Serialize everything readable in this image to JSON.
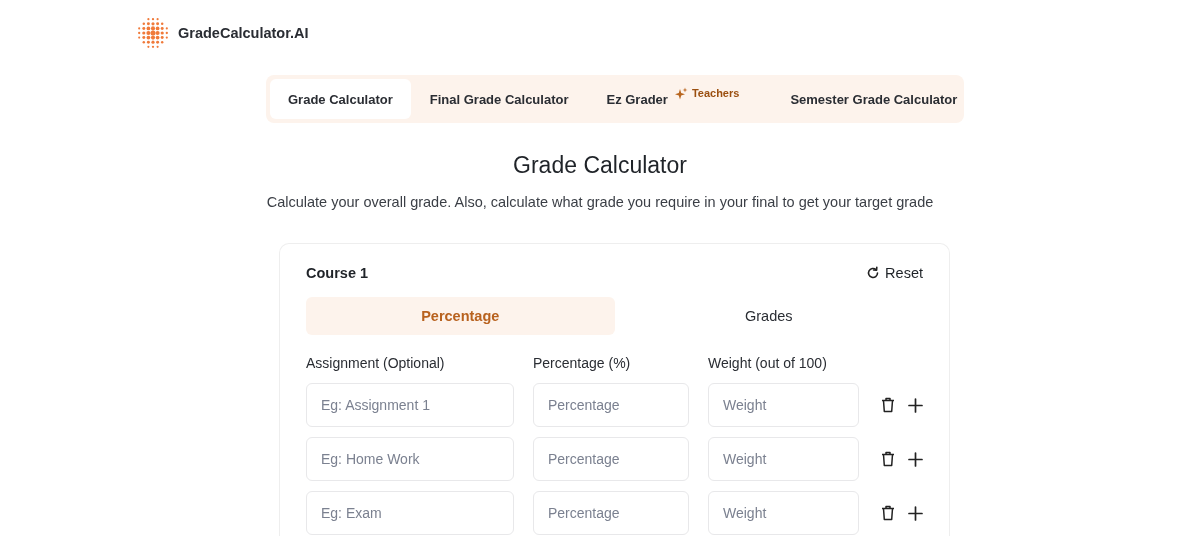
{
  "brand": {
    "name": "GradeCalculator.AI"
  },
  "tabs": [
    {
      "label": "Grade Calculator",
      "selected": true
    },
    {
      "label": "Final Grade Calculator",
      "selected": false
    },
    {
      "label": "Ez Grader",
      "selected": false,
      "badge": "Teachers"
    },
    {
      "label": "Semester Grade Calculator",
      "selected": false
    }
  ],
  "heading": "Grade Calculator",
  "subheading": "Calculate your overall grade. Also, calculate what grade you require in your final to get your target grade",
  "course": {
    "title": "Course 1",
    "reset": "Reset",
    "modes": [
      {
        "label": "Percentage",
        "selected": true
      },
      {
        "label": "Grades",
        "selected": false
      }
    ],
    "columns": [
      "Assignment (Optional)",
      "Percentage (%)",
      "Weight (out of 100)"
    ],
    "rows": [
      {
        "assignment": {
          "placeholder": "Eg: Assignment 1"
        },
        "percentage": {
          "placeholder": "Percentage"
        },
        "weight": {
          "placeholder": "Weight"
        }
      },
      {
        "assignment": {
          "placeholder": "Eg: Home Work"
        },
        "percentage": {
          "placeholder": "Percentage"
        },
        "weight": {
          "placeholder": "Weight"
        }
      },
      {
        "assignment": {
          "placeholder": "Eg: Exam"
        },
        "percentage": {
          "placeholder": "Percentage"
        },
        "weight": {
          "placeholder": "Weight"
        }
      }
    ]
  }
}
